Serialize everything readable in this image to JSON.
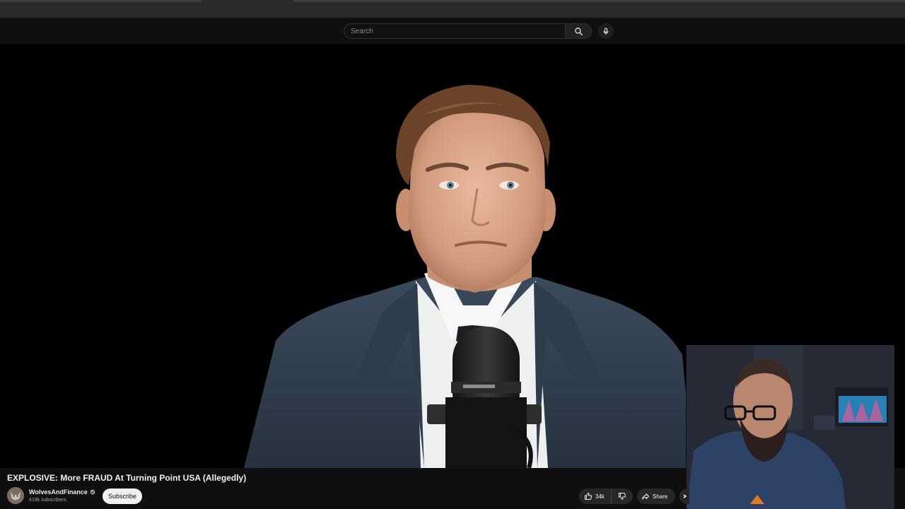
{
  "masthead": {
    "search_placeholder": "Search",
    "search_icon": "search-icon",
    "mic_icon": "microphone-icon"
  },
  "video": {
    "title": "EXPLOSIVE: More FRAUD At Turning Point USA (Allegedly)"
  },
  "channel": {
    "name": "WolvesAndFinance",
    "verified_icon": "verified-icon",
    "subscribers": "419k subscribers",
    "subscribe_label": "Subscribe"
  },
  "actions": {
    "like_count": "34k",
    "like_icon": "thumbs-up-icon",
    "dislike_icon": "thumbs-down-icon",
    "share_label": "Share",
    "share_icon": "share-arrow-icon"
  },
  "colors": {
    "page_bg": "#0f0f0f",
    "button_bg": "#272727",
    "subscribe_bg": "#f1f1f1"
  }
}
